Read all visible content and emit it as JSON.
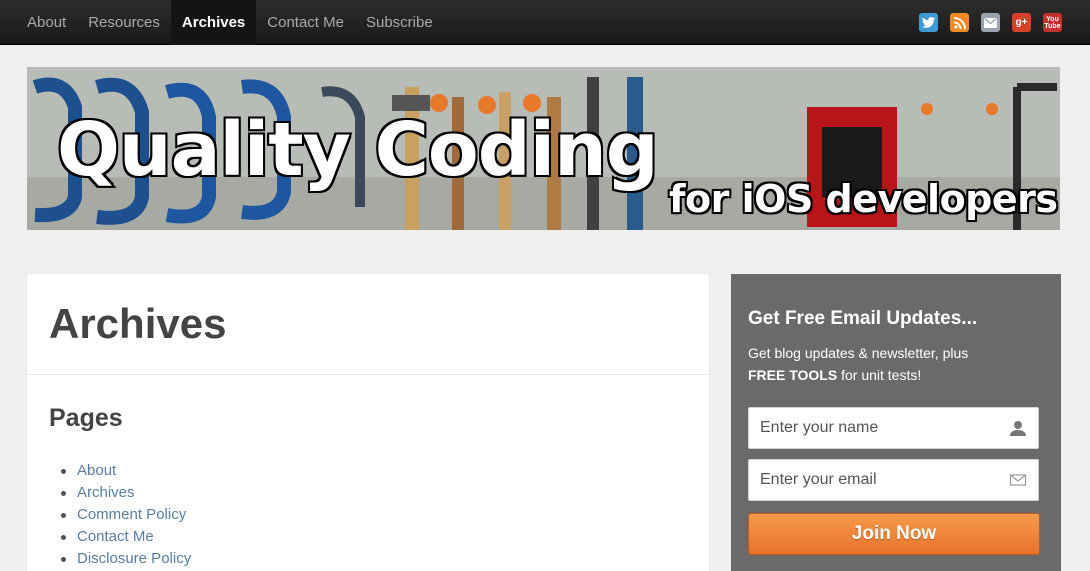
{
  "nav": {
    "items": [
      {
        "label": "About"
      },
      {
        "label": "Resources"
      },
      {
        "label": "Archives",
        "active": true
      },
      {
        "label": "Contact Me"
      },
      {
        "label": "Subscribe"
      }
    ],
    "social": [
      {
        "icon": "twitter-icon",
        "color": "#3d9ad6"
      },
      {
        "icon": "rss-icon",
        "color": "#f08a24"
      },
      {
        "icon": "email-icon",
        "color": "#9aa4b0"
      },
      {
        "icon": "google-plus-icon",
        "color": "#d6412c",
        "glyph": "g+"
      },
      {
        "icon": "youtube-icon",
        "color": "#c4302b",
        "glyph": "You Tube"
      }
    ]
  },
  "banner": {
    "title": "Quality Coding",
    "subtitle": "for iOS developers"
  },
  "main": {
    "heading": "Archives",
    "section_heading": "Pages",
    "links": [
      "About",
      "Archives",
      "Comment Policy",
      "Contact Me",
      "Disclosure Policy"
    ]
  },
  "optin": {
    "heading": "Get Free Email Updates...",
    "text_line1": "Get blog updates & newsletter, plus",
    "text_bold": "FREE TOOLS",
    "text_tail": " for unit tests!",
    "name_placeholder": "Enter your name",
    "email_placeholder": "Enter your email",
    "button_label": "Join Now"
  },
  "colors": {
    "accent": "#e8732a",
    "link": "#5a7fa0",
    "sidebar": "#6a6a6a"
  }
}
